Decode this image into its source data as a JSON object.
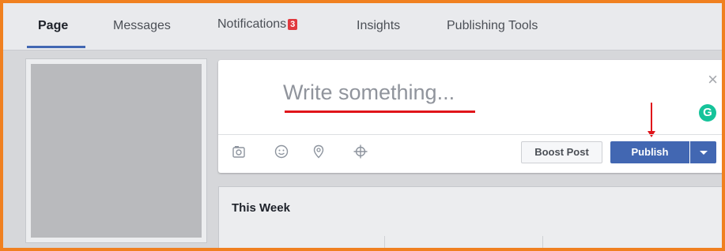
{
  "tabs": [
    {
      "label": "Page",
      "active": true
    },
    {
      "label": "Messages"
    },
    {
      "label": "Notifications",
      "badge": "3"
    },
    {
      "label": "Insights"
    },
    {
      "label": "Publishing Tools"
    }
  ],
  "composer": {
    "placeholder": "Write something...",
    "close_icon": "×",
    "grammarly_letter": "G",
    "tools": [
      "photo-camera-icon",
      "emoji-smiley-icon",
      "location-pin-icon",
      "target-crosshair-icon"
    ],
    "boost_label": "Boost Post",
    "publish_label": "Publish"
  },
  "this_week": {
    "title": "This Week"
  },
  "colors": {
    "accent": "#4267b2",
    "annotation_red": "#e0141a",
    "frame_orange": "#f08020",
    "badge_red": "#e0393e",
    "grammarly_green": "#15c39a"
  }
}
